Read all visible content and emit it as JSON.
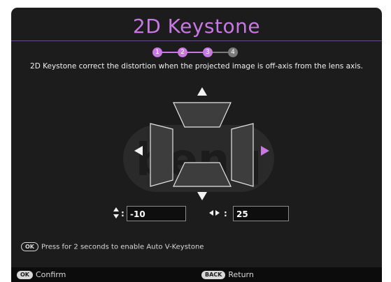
{
  "title": "2D Keystone",
  "steps": [
    {
      "label": "1",
      "state": "active"
    },
    {
      "label": "2",
      "state": "active"
    },
    {
      "label": "3",
      "state": "active"
    },
    {
      "label": "4",
      "state": "inactive"
    }
  ],
  "description": "2D Keystone correct the distortion when the projected image is off-axis from the lens axis.",
  "vertical": {
    "value": "-10",
    "icon": "up-down-arrows-icon"
  },
  "horizontal": {
    "value": "25",
    "icon": "left-right-arrows-icon"
  },
  "hint": {
    "key_label": "OK",
    "text": "Press for 2 seconds to enable Auto V-Keystone"
  },
  "footer": {
    "confirm_key": "OK",
    "confirm_label": "Confirm",
    "back_key": "BACK",
    "back_label": "Return"
  },
  "colors": {
    "accent": "#c779e3",
    "background": "#1c1c1c",
    "inactive_step": "#7a7a7a",
    "trapezoid_fill": "#3d3d3d"
  }
}
